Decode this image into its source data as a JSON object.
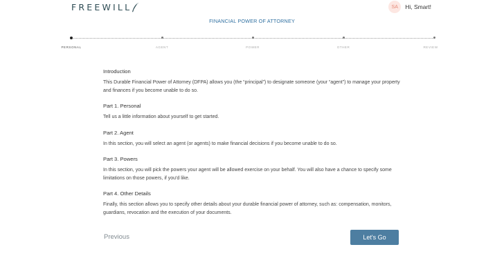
{
  "header": {
    "logo_text": "FREEWILL",
    "user_initials": "SA",
    "greeting": "Hi, Smart!"
  },
  "form_title": "FINANCIAL POWER OF ATTORNEY",
  "steps": [
    {
      "label": "PERSONAL",
      "active": true
    },
    {
      "label": "AGENT",
      "active": false
    },
    {
      "label": "POWER",
      "active": false
    },
    {
      "label": "OTHER",
      "active": false
    },
    {
      "label": "REVIEW",
      "active": false
    }
  ],
  "sections": [
    {
      "title": "Introduction",
      "text": "This Durable Financial Power of Attorney (DFPA) allows you (the “principal”) to designate someone (your “agent”) to manage your property and finances if you become unable to do so."
    },
    {
      "title": "Part 1. Personal",
      "text": "Tell us a little information about yourself to get started."
    },
    {
      "title": "Part 2. Agent",
      "text": "In this section, you will select an agent (or agents) to make financial decisions if you become unable to do so."
    },
    {
      "title": "Part 3. Powers",
      "text": "In this section, you will pick the powers your agent will be allowed exercise on your behalf. You will also have a chance to specify some limitations on those powers, if you'd like."
    },
    {
      "title": "Part 4. Other Details",
      "text": "Finally, this section allows you to specify other details about your durable financial power of attorney, such as: compensation, monitors, guardians, revocation and the execution of your documents."
    }
  ],
  "nav": {
    "previous_label": "Previous",
    "next_label": "Let's Go"
  },
  "colors": {
    "brand": "#2f4d55",
    "title": "#2e6fa0",
    "primary_button": "#4d7ea1",
    "avatar_bg": "#fde7e2"
  }
}
